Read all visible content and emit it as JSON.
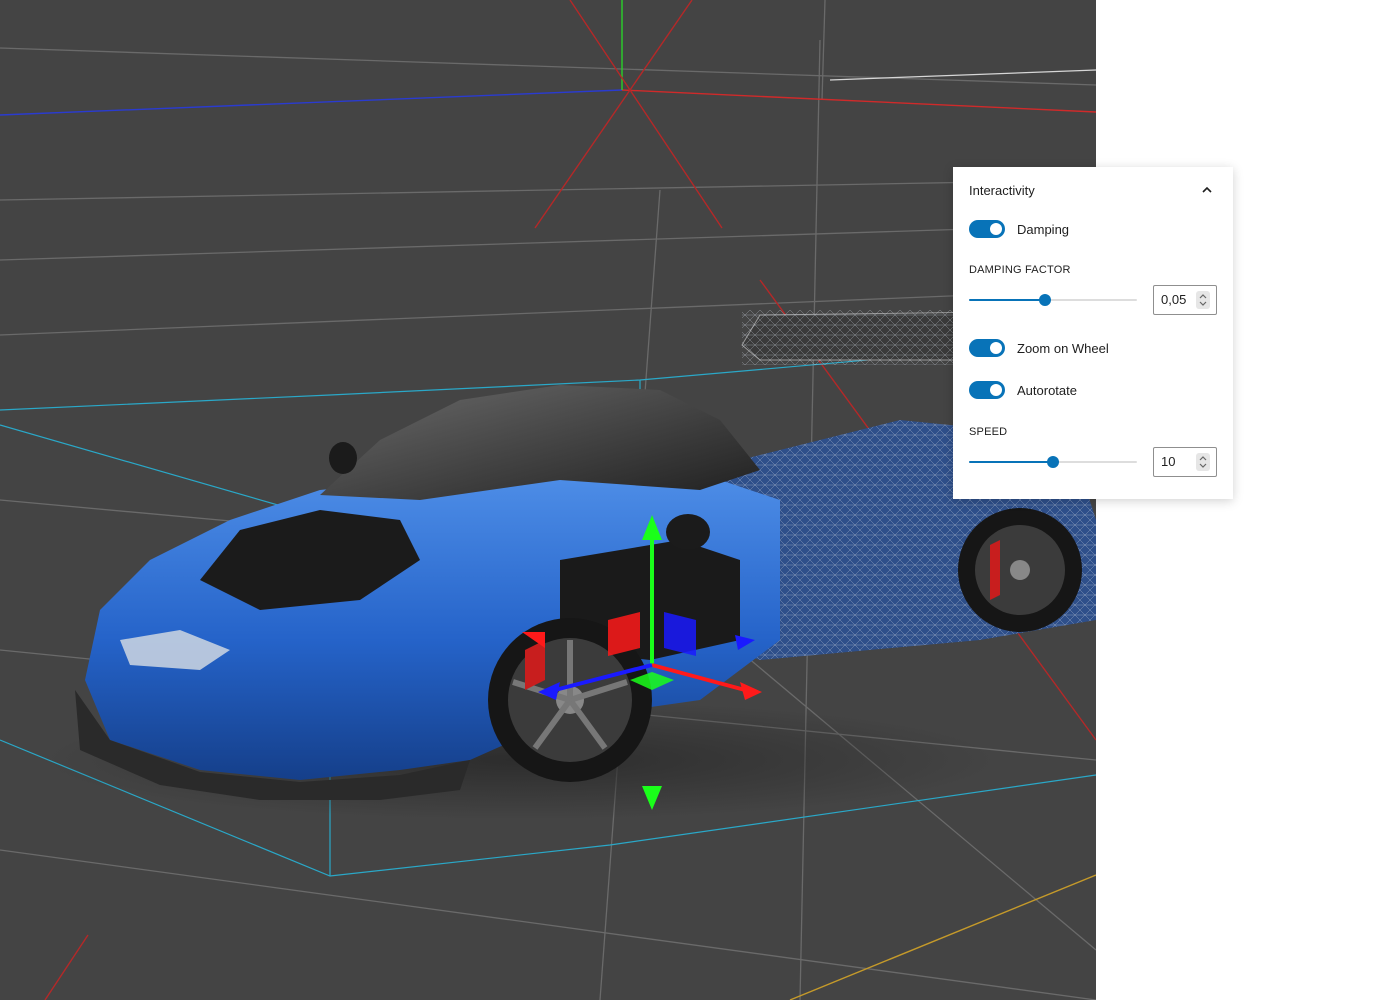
{
  "panel": {
    "title": "Interactivity",
    "collapse_icon": "chevron-up-icon",
    "accent_color": "#0873b8",
    "damping": {
      "label": "Damping",
      "enabled": true
    },
    "damping_factor": {
      "label": "DAMPING FACTOR",
      "value": "0,05",
      "slider_fraction": 0.45
    },
    "zoom_on_wheel": {
      "label": "Zoom on Wheel",
      "enabled": true
    },
    "autorotate": {
      "label": "Autorotate",
      "enabled": true
    },
    "speed": {
      "label": "SPEED",
      "value": "10",
      "slider_fraction": 0.5
    }
  },
  "viewport": {
    "scene": "blue sports car 3d model with transform gizmo and wireframe view",
    "background_color": "#444444",
    "gizmo_colors": {
      "x": "#ff1a1a",
      "y": "#1aff1a",
      "z": "#1a1aff"
    }
  }
}
